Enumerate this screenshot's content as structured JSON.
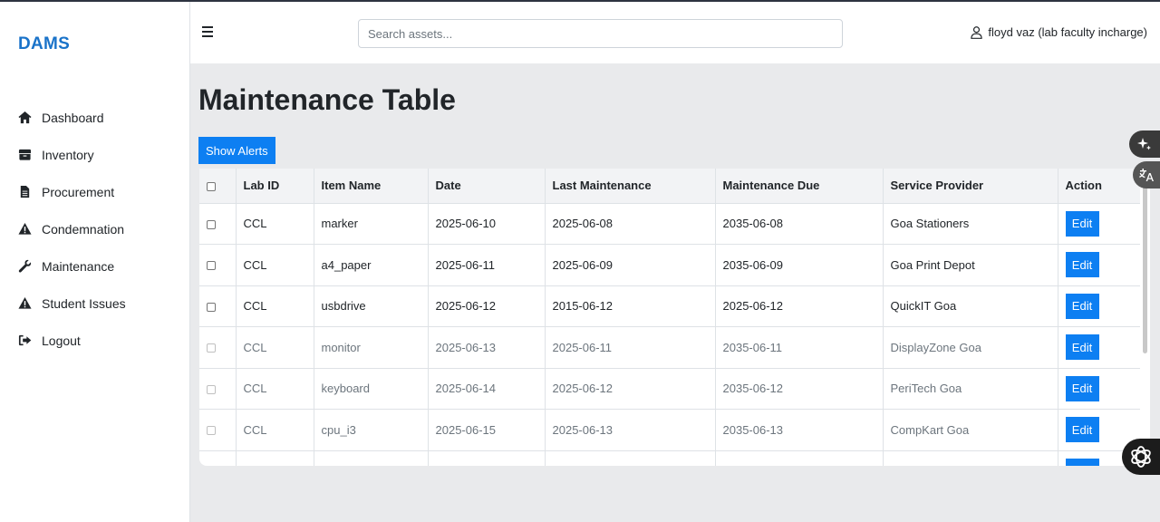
{
  "app": {
    "brand": "DAMS"
  },
  "sidebar": {
    "items": [
      {
        "label": "Dashboard",
        "icon": "home-icon"
      },
      {
        "label": "Inventory",
        "icon": "box-icon"
      },
      {
        "label": "Procurement",
        "icon": "file-icon"
      },
      {
        "label": "Condemnation",
        "icon": "warning-icon"
      },
      {
        "label": "Maintenance",
        "icon": "wrench-icon"
      },
      {
        "label": "Student Issues",
        "icon": "warning-icon"
      },
      {
        "label": "Logout",
        "icon": "sign-out-icon"
      }
    ]
  },
  "header": {
    "search_placeholder": "Search assets...",
    "user": "floyd vaz (lab faculty incharge)"
  },
  "main": {
    "title": "Maintenance Table",
    "show_alerts_label": "Show Alerts"
  },
  "table": {
    "columns": [
      "Lab ID",
      "Item Name",
      "Date",
      "Last Maintenance",
      "Maintenance Due",
      "Service Provider",
      "Action"
    ],
    "edit_label": "Edit",
    "rows": [
      {
        "lab_id": "CCL",
        "item": "marker",
        "date": "2025-06-10",
        "last": "2025-06-08",
        "due": "2035-06-08",
        "provider": "Goa Stationers",
        "disabled": false
      },
      {
        "lab_id": "CCL",
        "item": "a4_paper",
        "date": "2025-06-11",
        "last": "2025-06-09",
        "due": "2035-06-09",
        "provider": "Goa Print Depot",
        "disabled": false
      },
      {
        "lab_id": "CCL",
        "item": "usbdrive",
        "date": "2025-06-12",
        "last": "2015-06-12",
        "due": "2025-06-12",
        "provider": "QuickIT Goa",
        "disabled": false
      },
      {
        "lab_id": "CCL",
        "item": "monitor",
        "date": "2025-06-13",
        "last": "2025-06-11",
        "due": "2035-06-11",
        "provider": "DisplayZone Goa",
        "disabled": true
      },
      {
        "lab_id": "CCL",
        "item": "keyboard",
        "date": "2025-06-14",
        "last": "2025-06-12",
        "due": "2035-06-12",
        "provider": "PeriTech Goa",
        "disabled": true
      },
      {
        "lab_id": "CCL",
        "item": "cpu_i3",
        "date": "2025-06-15",
        "last": "2025-06-13",
        "due": "2035-06-13",
        "provider": "CompKart Goa",
        "disabled": true
      }
    ]
  },
  "colors": {
    "accent": "#0d7ff2",
    "brand": "#1a73c9"
  }
}
